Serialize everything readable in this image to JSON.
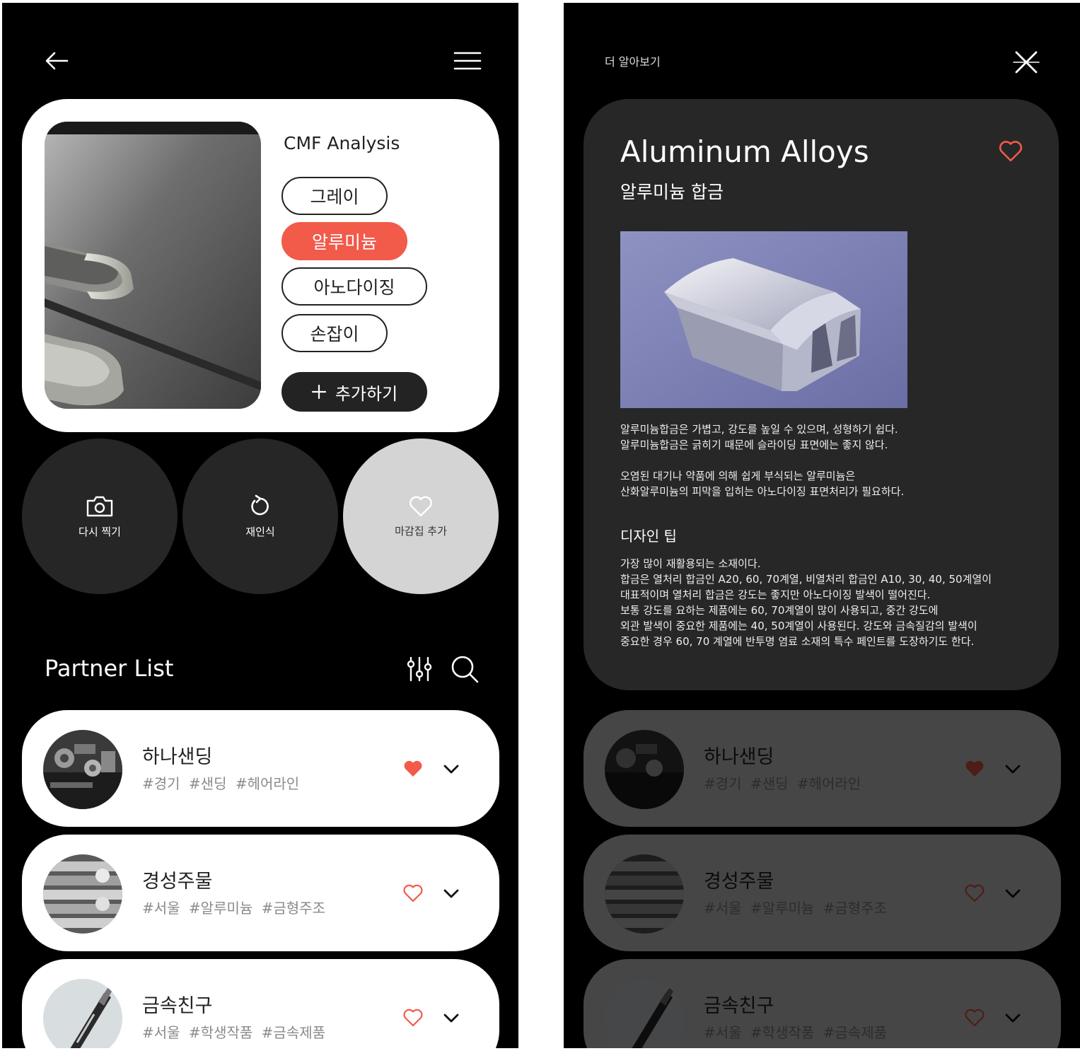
{
  "colors": {
    "accent": "#f25a4a",
    "dark": "#232323",
    "card": "#272727"
  },
  "cmf": {
    "title": "CMF Analysis",
    "chips": [
      "그레이",
      "알루미늄",
      "아노다이징",
      "손잡이"
    ],
    "add_label": "추가하기"
  },
  "actions": {
    "retake": "다시 찍기",
    "rescan": "재인식",
    "add_finish": "마감집 추가"
  },
  "partner_list": {
    "title": "Partner List",
    "items": [
      {
        "name": "하나샌딩",
        "tags": "#경기 #샌딩 #헤어라인",
        "favorite": true
      },
      {
        "name": "경성주물",
        "tags": "#서울 #알루미늄 #금형주조",
        "favorite": false
      },
      {
        "name": "금속친구",
        "tags": "#서울 #학생작품 #금속제품",
        "favorite": false
      }
    ]
  },
  "detail": {
    "header_label": "더 알아보기",
    "title": "Aluminum Alloys",
    "subtitle": "알루미늄 합금",
    "para1": "알루미늄합금은 가볍고, 강도를 높일 수 있으며, 성형하기 쉽다.\n알루미늄합금은 긁히기 때문에 슬라이딩 표면에는 좋지 않다.",
    "para2": "오염된 대기나 약품에 의해 쉽게 부식되는 알루미늄은\n산화알루미늄의 피막을 입히는 아노다이징 표면처리가 필요하다.",
    "tip_title": "디자인 팁",
    "tip_text": "가장 많이 재활용되는 소재이다.\n합금은 열처리 합금인 A20, 60, 70계열, 비열처리 합금인 A10, 30, 40, 50계열이\n대표적이며 열처리 합금은 강도는 좋지만 아노다이징 발색이 떨어진다.\n보통 강도를 요하는 제품에는 60, 70계열이 많이 사용되고, 중간 강도에\n외관 발색이 중요한 제품에는 40, 50계열이 사용된다. 강도와 금속질감의 발색이\n중요한 경우 60, 70 계열에 반투명 염료 소재의 특수 페인트를 도장하기도 한다."
  }
}
